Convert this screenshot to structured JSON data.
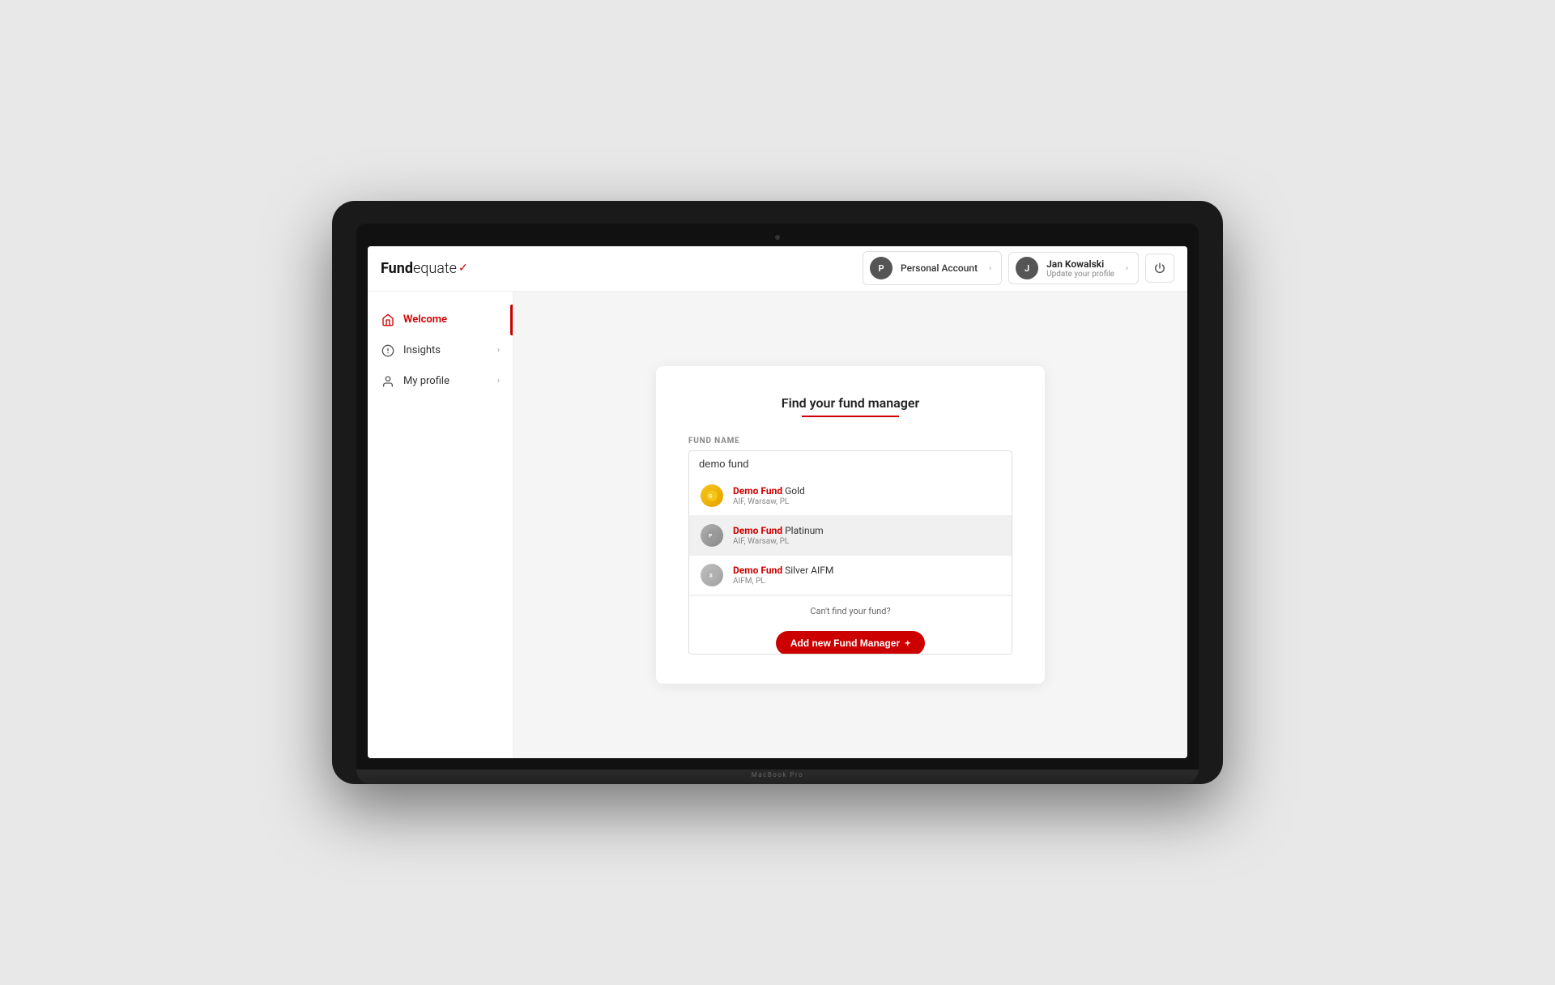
{
  "logo": {
    "fund": "Fund",
    "equate": "equate",
    "symbol": "✓"
  },
  "header": {
    "account": {
      "avatar_letter": "P",
      "name": "Personal Account",
      "chevron": "›"
    },
    "user": {
      "avatar_letter": "J",
      "name": "Jan Kowalski",
      "subtitle": "Update your profile",
      "chevron": "›"
    },
    "power_icon": "⏻"
  },
  "sidebar": {
    "items": [
      {
        "id": "welcome",
        "label": "Welcome",
        "active": true,
        "has_chevron": false
      },
      {
        "id": "insights",
        "label": "Insights",
        "active": false,
        "has_chevron": true
      },
      {
        "id": "my-profile",
        "label": "My profile",
        "active": false,
        "has_chevron": true
      }
    ]
  },
  "main": {
    "card": {
      "title": "Find your fund manager",
      "field_label": "FUND NAME",
      "input_value": "demo fund",
      "dropdown": {
        "items": [
          {
            "id": "gold",
            "name_bold": "Demo Fund",
            "name_rest": " Gold",
            "sub": "AIF, Warsaw, PL",
            "avatar_type": "gold",
            "avatar_char": "🔶"
          },
          {
            "id": "platinum",
            "name_bold": "Demo Fund",
            "name_rest": " Platinum",
            "sub": "AIF, Warsaw, PL",
            "avatar_type": "platinum",
            "avatar_char": "⬡"
          },
          {
            "id": "silver",
            "name_bold": "Demo Fund",
            "name_rest": " Silver AIFM",
            "sub": "AIFM, PL",
            "avatar_type": "silver",
            "avatar_char": "⬡"
          }
        ],
        "cant_find_text": "Can't find your fund?",
        "add_button_label": "Add new Fund Manager",
        "add_button_plus": "+"
      }
    }
  },
  "macbook_label": "MacBook Pro"
}
